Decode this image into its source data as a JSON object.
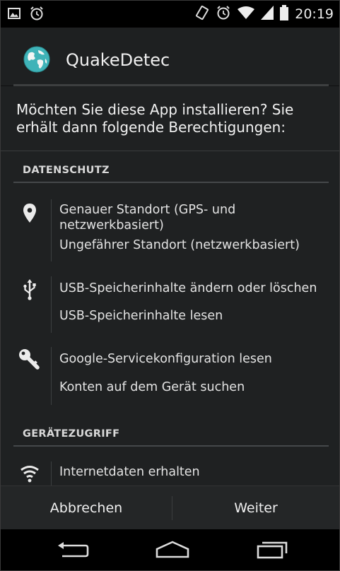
{
  "status_bar": {
    "left_icons": [
      "image-icon",
      "alarm-icon"
    ],
    "right_icons": [
      "rotation-icon",
      "alarm-icon",
      "wifi-icon",
      "signal-icon",
      "battery-icon"
    ],
    "time": "20:19"
  },
  "app": {
    "name": "QuakeDetec",
    "icon": "globe-icon"
  },
  "prompt": "Möchten Sie diese App installieren? Sie erhält dann folgende Berechtigungen:",
  "sections": {
    "privacy": "DATENSCHUTZ",
    "device_access": "GERÄTEZUGRIFF"
  },
  "permissions": {
    "location": {
      "icon": "location-pin-icon",
      "items": [
        "Genauer Standort (GPS- und netzwerkbasiert)",
        "Ungefährer Standort (netzwerkbasiert)"
      ]
    },
    "storage": {
      "icon": "usb-icon",
      "items": [
        "USB-Speicherinhalte ändern oder löschen",
        "USB-Speicherinhalte lesen"
      ]
    },
    "accounts": {
      "icon": "key-icon",
      "items": [
        "Google-Servicekonfiguration lesen",
        "Konten auf dem Gerät suchen"
      ]
    },
    "network": {
      "icon": "wifi-icon",
      "items": [
        "Internetdaten erhalten"
      ]
    }
  },
  "actions": {
    "cancel": "Abbrechen",
    "next": "Weiter"
  },
  "navigation": [
    "back-icon",
    "home-icon",
    "recents-icon"
  ],
  "colors": {
    "background": "#1f2122",
    "status_bar": "#000000",
    "divider": "#45484a",
    "text": "#e3e3e3"
  }
}
